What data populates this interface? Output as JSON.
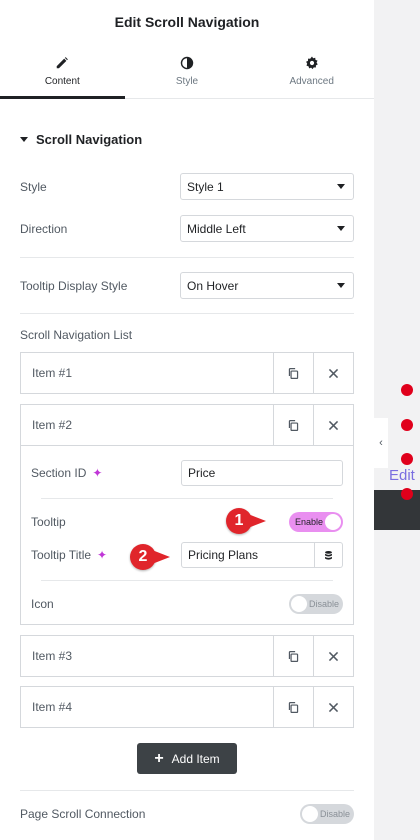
{
  "header": {
    "title": "Edit Scroll Navigation"
  },
  "tabs": [
    {
      "label": "Content",
      "icon": "pencil-icon",
      "active": true
    },
    {
      "label": "Style",
      "icon": "half-circle-icon",
      "active": false
    },
    {
      "label": "Advanced",
      "icon": "gear-icon",
      "active": false
    }
  ],
  "section": {
    "title": "Scroll Navigation"
  },
  "controls": {
    "style": {
      "label": "Style",
      "value": "Style 1"
    },
    "direction": {
      "label": "Direction",
      "value": "Middle Left"
    },
    "tooltip_display": {
      "label": "Tooltip Display Style",
      "value": "On Hover"
    },
    "list_label": "Scroll Navigation List"
  },
  "items": [
    {
      "title": "Item #1"
    },
    {
      "title": "Item #2"
    },
    {
      "title": "Item #3"
    },
    {
      "title": "Item #4"
    }
  ],
  "item2": {
    "section_id_label": "Section ID",
    "section_id_value": "Price",
    "tooltip_label": "Tooltip",
    "tooltip_toggle": "Enable",
    "tooltip_title_label": "Tooltip Title",
    "tooltip_title_value": "Pricing Plans",
    "icon_label": "Icon",
    "icon_toggle": "Disable"
  },
  "badges": {
    "one": "1",
    "two": "2"
  },
  "add_item": {
    "label": "Add Item"
  },
  "page_scroll": {
    "label": "Page Scroll Connection",
    "toggle": "Disable"
  },
  "preview": {
    "edit_link": "Edit"
  },
  "colors": {
    "accent_toggle": "#e98ff0",
    "badge": "#e0252b",
    "dot": "#e0001b",
    "button_dark": "#3d4246"
  }
}
